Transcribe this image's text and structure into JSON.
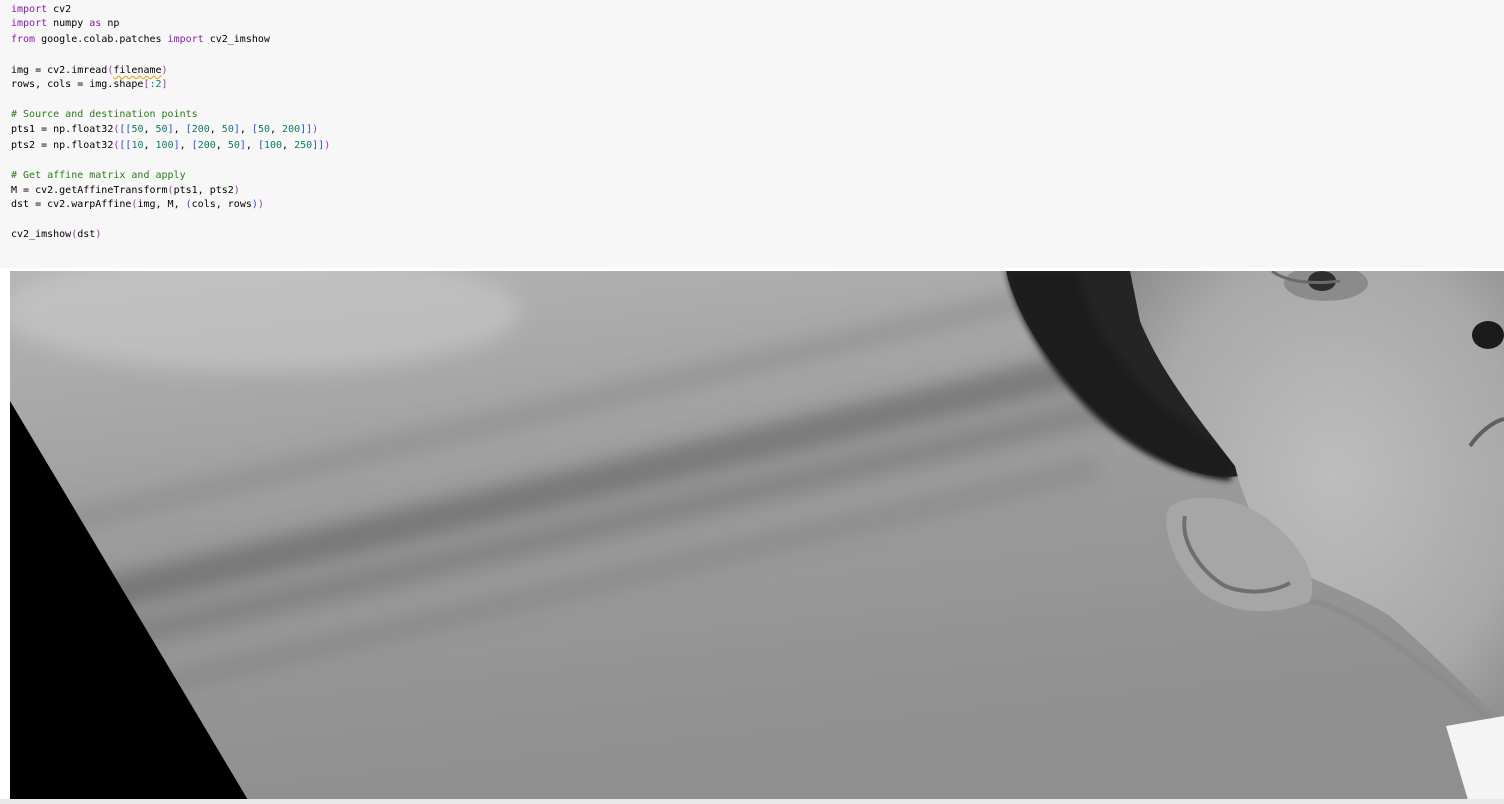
{
  "code_cell": {
    "lines": [
      {
        "segments": [
          {
            "cls": "kw",
            "text": "import"
          },
          {
            "cls": "",
            "text": " cv2"
          }
        ]
      },
      {
        "segments": [
          {
            "cls": "kw",
            "text": "import"
          },
          {
            "cls": "",
            "text": " numpy "
          },
          {
            "cls": "kw",
            "text": "as"
          },
          {
            "cls": "",
            "text": " np"
          }
        ]
      },
      {
        "segments": [
          {
            "cls": "kw",
            "text": "from"
          },
          {
            "cls": "",
            "text": " google.colab.patches "
          },
          {
            "cls": "kw",
            "text": "import"
          },
          {
            "cls": "",
            "text": " cv2_imshow"
          }
        ]
      },
      {
        "segments": []
      },
      {
        "segments": [
          {
            "cls": "",
            "text": "img = cv2.imread"
          },
          {
            "cls": "br2",
            "text": "("
          },
          {
            "cls": "squig",
            "text": "filename"
          },
          {
            "cls": "br2",
            "text": ")"
          }
        ]
      },
      {
        "segments": [
          {
            "cls": "",
            "text": "rows, cols = img.shape"
          },
          {
            "cls": "br2",
            "text": "["
          },
          {
            "cls": "num",
            "text": ":2"
          },
          {
            "cls": "br2",
            "text": "]"
          }
        ]
      },
      {
        "segments": []
      },
      {
        "segments": [
          {
            "cls": "cm",
            "text": "# Source and destination points"
          }
        ]
      },
      {
        "segments": [
          {
            "cls": "",
            "text": "pts1 = np.float32"
          },
          {
            "cls": "br2",
            "text": "("
          },
          {
            "cls": "br",
            "text": "[["
          },
          {
            "cls": "num",
            "text": "50"
          },
          {
            "cls": "",
            "text": ", "
          },
          {
            "cls": "num",
            "text": "50"
          },
          {
            "cls": "br",
            "text": "]"
          },
          {
            "cls": "",
            "text": ", "
          },
          {
            "cls": "br",
            "text": "["
          },
          {
            "cls": "num",
            "text": "200"
          },
          {
            "cls": "",
            "text": ", "
          },
          {
            "cls": "num",
            "text": "50"
          },
          {
            "cls": "br",
            "text": "]"
          },
          {
            "cls": "",
            "text": ", "
          },
          {
            "cls": "br",
            "text": "["
          },
          {
            "cls": "num",
            "text": "50"
          },
          {
            "cls": "",
            "text": ", "
          },
          {
            "cls": "num",
            "text": "200"
          },
          {
            "cls": "br",
            "text": "]]"
          },
          {
            "cls": "br2",
            "text": ")"
          }
        ]
      },
      {
        "segments": [
          {
            "cls": "",
            "text": "pts2 = np.float32"
          },
          {
            "cls": "br2",
            "text": "("
          },
          {
            "cls": "br",
            "text": "[["
          },
          {
            "cls": "num",
            "text": "10"
          },
          {
            "cls": "",
            "text": ", "
          },
          {
            "cls": "num",
            "text": "100"
          },
          {
            "cls": "br",
            "text": "]"
          },
          {
            "cls": "",
            "text": ", "
          },
          {
            "cls": "br",
            "text": "["
          },
          {
            "cls": "num",
            "text": "200"
          },
          {
            "cls": "",
            "text": ", "
          },
          {
            "cls": "num",
            "text": "50"
          },
          {
            "cls": "br",
            "text": "]"
          },
          {
            "cls": "",
            "text": ", "
          },
          {
            "cls": "br",
            "text": "["
          },
          {
            "cls": "num",
            "text": "100"
          },
          {
            "cls": "",
            "text": ", "
          },
          {
            "cls": "num",
            "text": "250"
          },
          {
            "cls": "br",
            "text": "]]"
          },
          {
            "cls": "br2",
            "text": ")"
          }
        ]
      },
      {
        "segments": []
      },
      {
        "segments": [
          {
            "cls": "cm",
            "text": "# Get affine matrix and apply"
          }
        ]
      },
      {
        "segments": [
          {
            "cls": "",
            "text": "M = cv2.getAffineTransform"
          },
          {
            "cls": "br2",
            "text": "("
          },
          {
            "cls": "",
            "text": "pts1, pts2"
          },
          {
            "cls": "br2",
            "text": ")"
          }
        ]
      },
      {
        "segments": [
          {
            "cls": "",
            "text": "dst = cv2.warpAffine"
          },
          {
            "cls": "br2",
            "text": "("
          },
          {
            "cls": "",
            "text": "img, M, "
          },
          {
            "cls": "br",
            "text": "("
          },
          {
            "cls": "",
            "text": "cols, rows"
          },
          {
            "cls": "br",
            "text": ")"
          },
          {
            "cls": "br2",
            "text": ")"
          }
        ]
      },
      {
        "segments": []
      },
      {
        "segments": [
          {
            "cls": "",
            "text": "cv2_imshow"
          },
          {
            "cls": "br2",
            "text": "("
          },
          {
            "cls": "",
            "text": "dst"
          },
          {
            "cls": "br2",
            "text": ")"
          }
        ]
      }
    ]
  },
  "output": {
    "image_description_icon": "grayscale-photo-output"
  },
  "colors": {
    "keyword": "#8a1aa3",
    "comment": "#2d7a1a",
    "number": "#0c7a66",
    "cell_background": "#f7f7f7"
  }
}
